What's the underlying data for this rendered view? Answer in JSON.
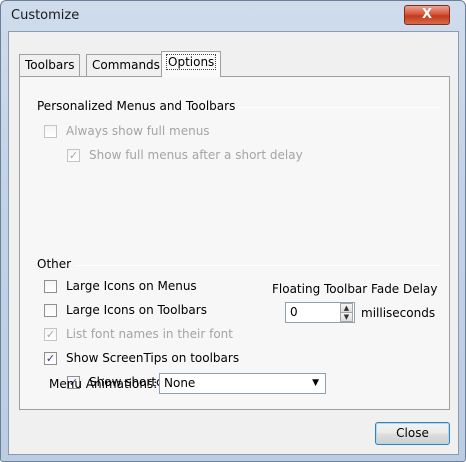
{
  "window": {
    "title": "Customize",
    "close_glyph": "X"
  },
  "tabs": [
    {
      "label": "Toolbars",
      "active": false
    },
    {
      "label": "Commands",
      "active": false
    },
    {
      "label": "Options",
      "active": true
    }
  ],
  "personalized": {
    "heading": "Personalized Menus and Toolbars",
    "always_show_full_menus": {
      "label": "Always show full menus",
      "checked": false,
      "enabled": false
    },
    "show_full_after_delay": {
      "label": "Show full menus after a short delay",
      "checked": true,
      "enabled": false
    }
  },
  "other": {
    "heading": "Other",
    "large_icons_menus": {
      "label": "Large Icons on Menus",
      "checked": false,
      "enabled": true
    },
    "large_icons_toolbars": {
      "label": "Large Icons on Toolbars",
      "checked": false,
      "enabled": true
    },
    "list_font_names": {
      "label": "List font names in their font",
      "checked": true,
      "enabled": false
    },
    "show_screentips": {
      "label": "Show ScreenTips on toolbars",
      "checked": true,
      "enabled": true
    },
    "show_shortcut_keys": {
      "label": "Show shortcut keys in ScreenTips",
      "checked": true,
      "enabled": true
    },
    "fade_delay": {
      "label": "Floating Toolbar Fade Delay",
      "value": "0",
      "unit": "milliseconds"
    },
    "menu_animations": {
      "label": "Menu Animations:",
      "value": "None"
    }
  },
  "buttons": {
    "close_label": "Close"
  },
  "glyphs": {
    "check": "✓",
    "spin_up": "▲",
    "spin_down": "▼",
    "dropdown": "▼"
  },
  "colors": {
    "title_bar": "#c3d3e7",
    "close_button": "#c23a1c",
    "disabled_text": "#a4a4a4",
    "default_button_border": "#3c7fb1"
  }
}
